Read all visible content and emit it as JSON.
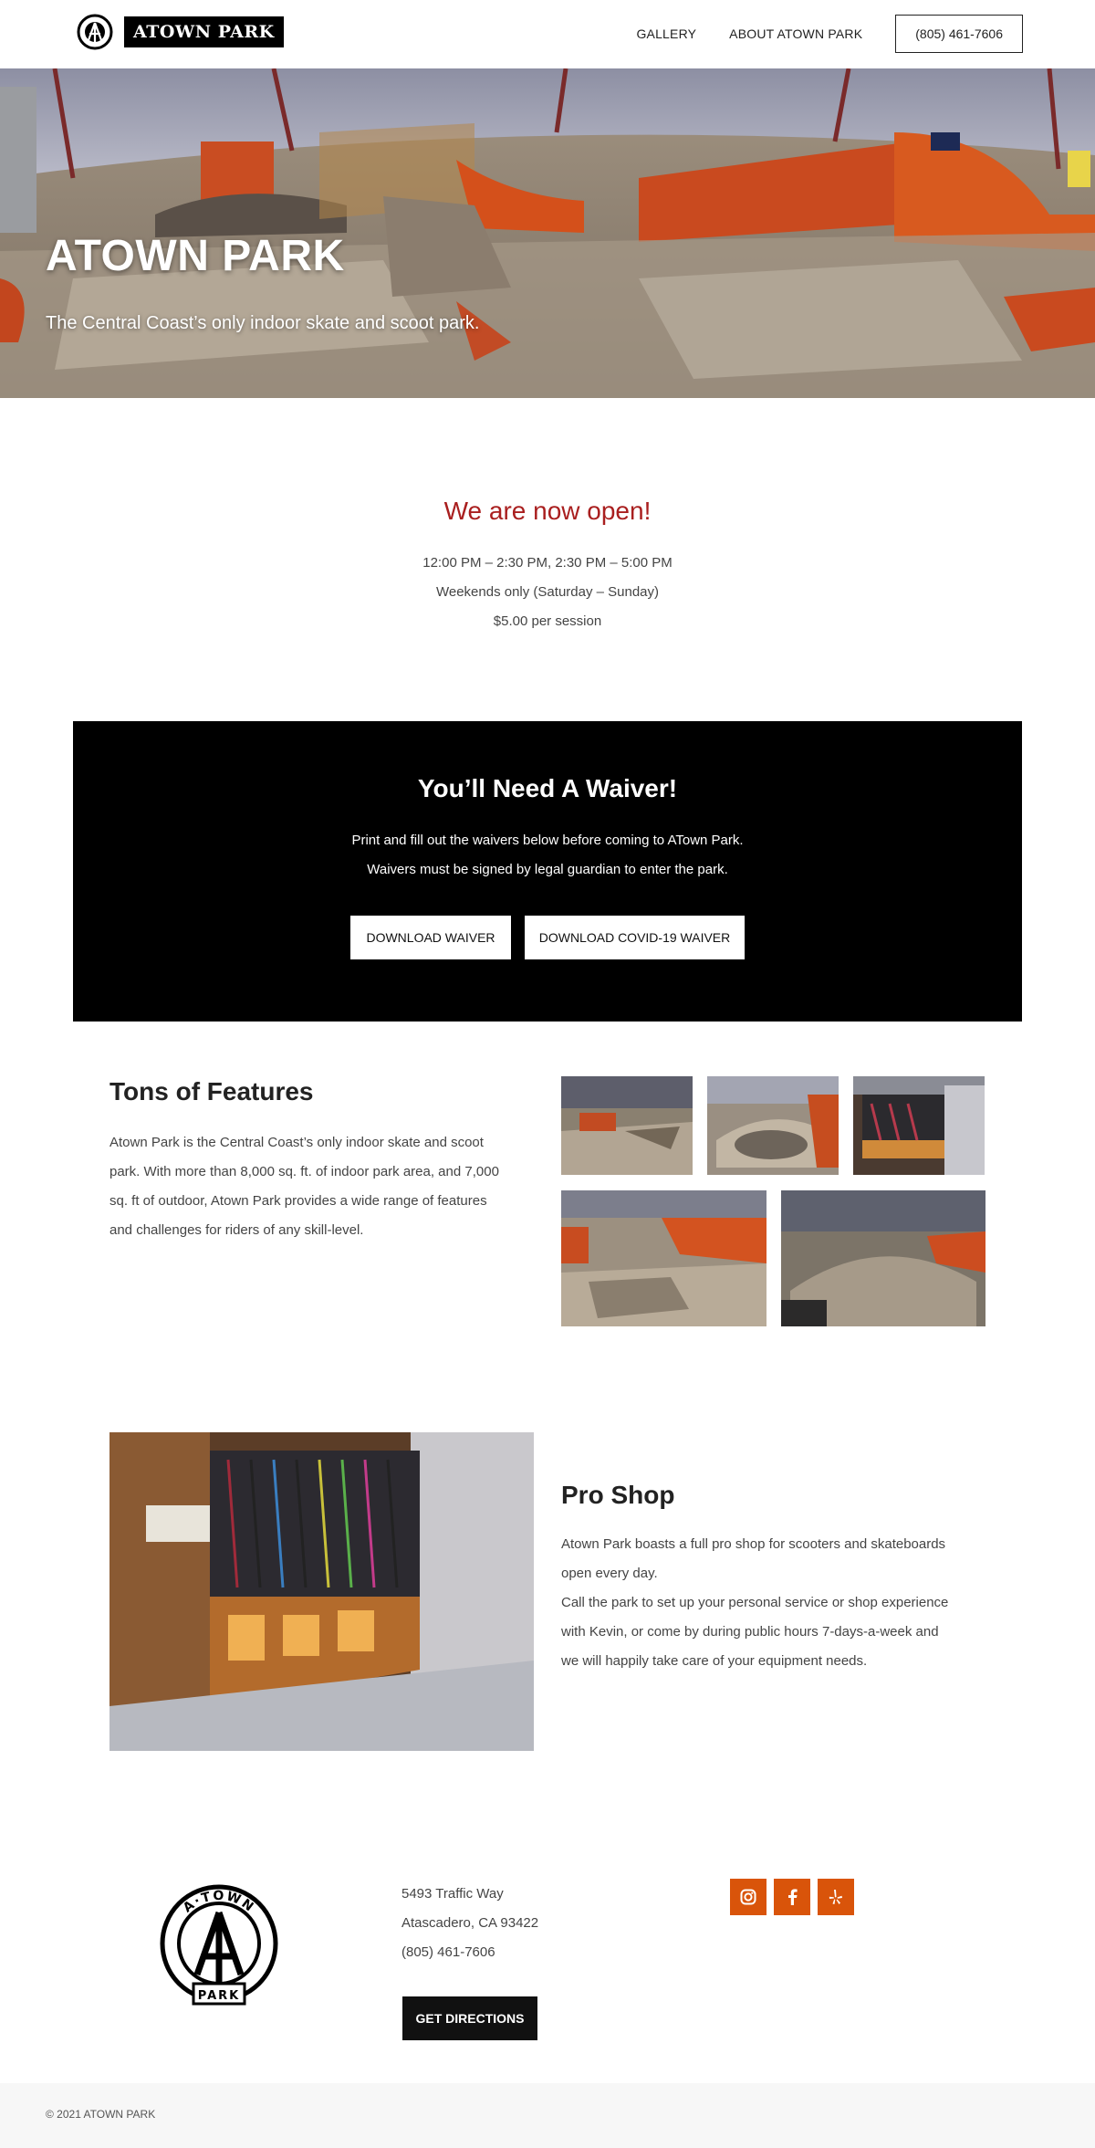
{
  "header": {
    "logo_text": "ATOWN PARK",
    "nav": [
      "GALLERY",
      "ABOUT ATOWN PARK"
    ],
    "phone_button": "(805) 461-7606"
  },
  "hero": {
    "title": "ATOWN PARK",
    "subtitle": "The Central Coast’s only indoor skate and scoot park."
  },
  "open": {
    "title": "We are now open!",
    "lines": [
      "12:00 PM – 2:30 PM, 2:30 PM – 5:00 PM",
      "Weekends only (Saturday – Sunday)",
      "$5.00 per session"
    ]
  },
  "waiver": {
    "title": "You’ll Need A Waiver!",
    "lines": [
      "Print and fill out the waivers below before coming to ATown Park.",
      "Waivers must be signed by legal guardian to enter the park."
    ],
    "buttons": [
      "DOWNLOAD WAIVER",
      "DOWNLOAD COVID-19 WAIVER"
    ]
  },
  "features": {
    "title": "Tons of Features",
    "lines": [
      "Atown Park is the Central Coast’s only indoor skate and scoot",
      "park. With more than 8,000 sq. ft. of indoor park area, and 7,000",
      "sq. ft of outdoor, Atown Park provides a wide range of features",
      "and challenges for riders of any skill-level."
    ]
  },
  "pro_shop": {
    "title": "Pro Shop",
    "lines": [
      "Atown Park boasts a full pro shop for scooters and skateboards",
      "open every day.",
      "Call the park to set up your personal service or shop experience",
      "with Kevin, or come by during public hours 7-days-a-week and",
      "we will happily take care of your equipment needs."
    ]
  },
  "footer": {
    "logo_top": "A·TOWN",
    "logo_bottom": "PARK",
    "address": [
      "5493 Traffic Way",
      "Atascadero, CA 93422",
      "(805) 461-7606"
    ],
    "directions_button": "GET DIRECTIONS",
    "social_icons": [
      "instagram-icon",
      "facebook-icon",
      "yelp-icon"
    ],
    "social_color": "#d9540a",
    "copyright": "© 2021 ATOWN PARK"
  },
  "colors": {
    "accent_red": "#a91f1f",
    "ramp_orange": "#d9501c",
    "black": "#000000"
  }
}
